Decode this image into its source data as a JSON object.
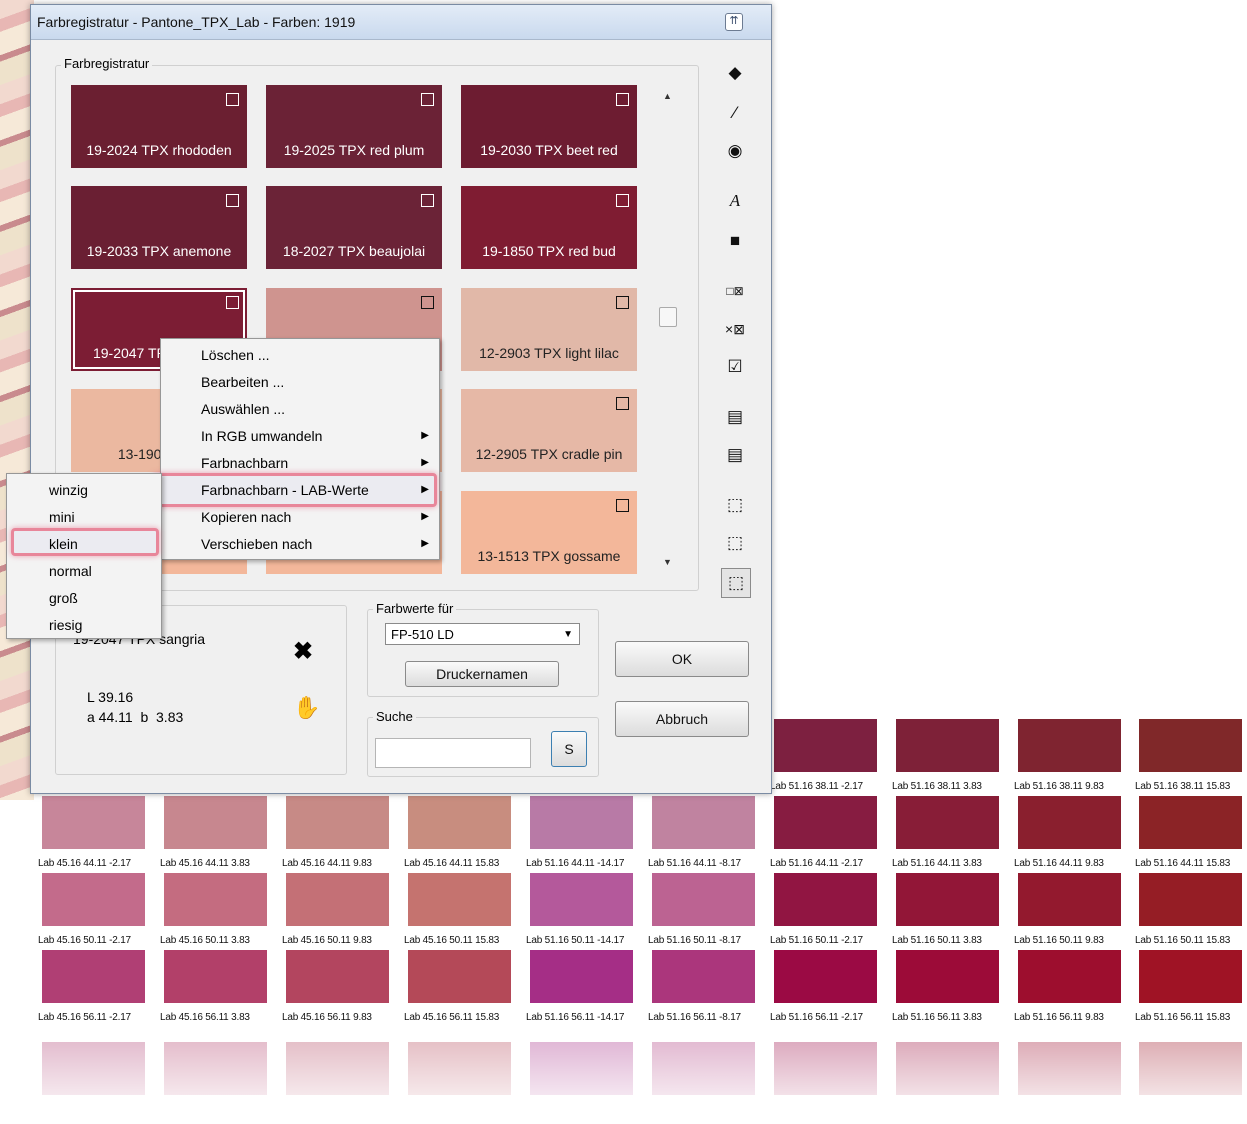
{
  "window": {
    "title": "Farbregistratur - Pantone_TPX_Lab - Farben: 1919",
    "title_button": "⇈"
  },
  "registry": {
    "group_label": "Farbregistratur",
    "swatches": [
      {
        "label": "19-2024 TPX rhododen",
        "color": "#6b1f31"
      },
      {
        "label": "19-2025 TPX red plum",
        "color": "#6b2236"
      },
      {
        "label": "19-2030 TPX beet red",
        "color": "#6d1c31"
      },
      {
        "label": "19-2033 TPX anemone",
        "color": "#6a1f33"
      },
      {
        "label": "18-2027 TPX beaujolai",
        "color": "#6b2337"
      },
      {
        "label": "19-1850 TPX red bud",
        "color": "#7f1c32"
      },
      {
        "label": "19-2047 TPX sangria",
        "color": "#7c1d34"
      },
      {
        "label": "",
        "color": "#cf948f"
      },
      {
        "label": "12-2903 TPX light lilac",
        "color": "#e1b8a8"
      },
      {
        "label": "13-1904 TPX",
        "color": "#ebb8a0"
      },
      {
        "label": "",
        "color": "#ebb8a0"
      },
      {
        "label": "12-2905 TPX cradle pin",
        "color": "#e6b8a6"
      },
      {
        "label": "",
        "color": "#f3b79a"
      },
      {
        "label": "",
        "color": "#f3b79a"
      },
      {
        "label": "13-1513 TPX gossame",
        "color": "#f3b79a"
      }
    ]
  },
  "context_menu": {
    "items": [
      "Löschen ...",
      "Bearbeiten ...",
      "Auswählen ...",
      "In RGB umwandeln",
      "Farbnachbarn",
      "Farbnachbarn - LAB-Werte",
      "Kopieren nach",
      "Verschieben nach"
    ],
    "submenu_flags": [
      false,
      false,
      false,
      true,
      true,
      true,
      true,
      true
    ],
    "highlighted": "Farbnachbarn - LAB-Werte"
  },
  "size_menu": {
    "items": [
      "winzig",
      "mini",
      "klein",
      "normal",
      "groß",
      "riesig"
    ],
    "highlighted": "klein"
  },
  "selected": {
    "name": "19-2047 TPX sangria",
    "name_visible": "19-2047 TPX sangria",
    "L": "L 39.16",
    "ab": "a 44.11  b  3.83"
  },
  "farbwerte": {
    "label": "Farbwerte für",
    "device": "FP-510 LD",
    "printer_button": "Druckernamen"
  },
  "search": {
    "label": "Suche",
    "value": "",
    "button": "S"
  },
  "buttons": {
    "ok": "OK",
    "cancel": "Abbruch"
  },
  "icons": [
    "paint-bucket-icon",
    "eyedropper-icon",
    "target-icon",
    "font-icon",
    "cube-icon",
    "swap-boxes-icon",
    "close-small-icon",
    "check-box-icon",
    "print-icon",
    "print-close-icon",
    "size-large-icon",
    "size-medium-icon",
    "size-small-icon"
  ],
  "lab_grid": {
    "rows": [
      {
        "cells": [
          {
            "label": "Lab 51.16 38.11 -2.17",
            "color": "#7d2040"
          },
          {
            "label": "Lab 51.16 38.11 3.83",
            "color": "#7e2138"
          },
          {
            "label": "Lab 51.16 38.11 9.83",
            "color": "#7f2430"
          },
          {
            "label": "Lab 51.16 38.11 15.83",
            "color": "#802829"
          }
        ]
      },
      {
        "cells": [
          {
            "label": "Lab 45.16 44.11 -2.17",
            "color": "#c7869a"
          },
          {
            "label": "Lab 45.16 44.11 3.83",
            "color": "#c7878f"
          },
          {
            "label": "Lab 45.16 44.11 9.83",
            "color": "#c78a86"
          },
          {
            "label": "Lab 45.16 44.11 15.83",
            "color": "#c88d7f"
          },
          {
            "label": "Lab 51.16 44.11 -14.17",
            "color": "#b87aa6"
          },
          {
            "label": "Lab 51.16 44.11 -8.17",
            "color": "#c083a0"
          },
          {
            "label": "Lab 51.16 44.11 -2.17",
            "color": "#871c41"
          },
          {
            "label": "Lab 51.16 44.11 3.83",
            "color": "#881d37"
          },
          {
            "label": "Lab 51.16 44.11 9.83",
            "color": "#8a1f2e"
          },
          {
            "label": "Lab 51.16 44.11 15.83",
            "color": "#8b2326"
          }
        ]
      },
      {
        "cells": [
          {
            "label": "Lab 45.16 50.11 -2.17",
            "color": "#c36b8b"
          },
          {
            "label": "Lab 45.16 50.11 3.83",
            "color": "#c46c80"
          },
          {
            "label": "Lab 45.16 50.11 9.83",
            "color": "#c47076"
          },
          {
            "label": "Lab 45.16 50.11 15.83",
            "color": "#c5736f"
          },
          {
            "label": "Lab 51.16 50.11 -14.17",
            "color": "#b4599b"
          },
          {
            "label": "Lab 51.16 50.11 -8.17",
            "color": "#bc6392"
          },
          {
            "label": "Lab 51.16 50.11 -2.17",
            "color": "#911542"
          },
          {
            "label": "Lab 51.16 50.11 3.83",
            "color": "#921637"
          },
          {
            "label": "Lab 51.16 50.11 9.83",
            "color": "#93192e"
          },
          {
            "label": "Lab 51.16 50.11 15.83",
            "color": "#951d25"
          }
        ]
      },
      {
        "cells": [
          {
            "label": "Lab 45.16 56.11 -2.17",
            "color": "#b03f74"
          },
          {
            "label": "Lab 45.16 56.11 3.83",
            "color": "#b24069"
          },
          {
            "label": "Lab 45.16 56.11 9.83",
            "color": "#b3455f"
          },
          {
            "label": "Lab 45.16 56.11 15.83",
            "color": "#b44958"
          },
          {
            "label": "Lab 51.16 56.11 -14.17",
            "color": "#a52e86"
          },
          {
            "label": "Lab 51.16 56.11 -8.17",
            "color": "#ab367c"
          },
          {
            "label": "Lab 51.16 56.11 -2.17",
            "color": "#9b0a44"
          },
          {
            "label": "Lab 51.16 56.11 3.83",
            "color": "#9c0b38"
          },
          {
            "label": "Lab 51.16 56.11 9.83",
            "color": "#9d0e2e"
          },
          {
            "label": "Lab 51.16 56.11 15.83",
            "color": "#9f1325"
          }
        ]
      }
    ]
  }
}
